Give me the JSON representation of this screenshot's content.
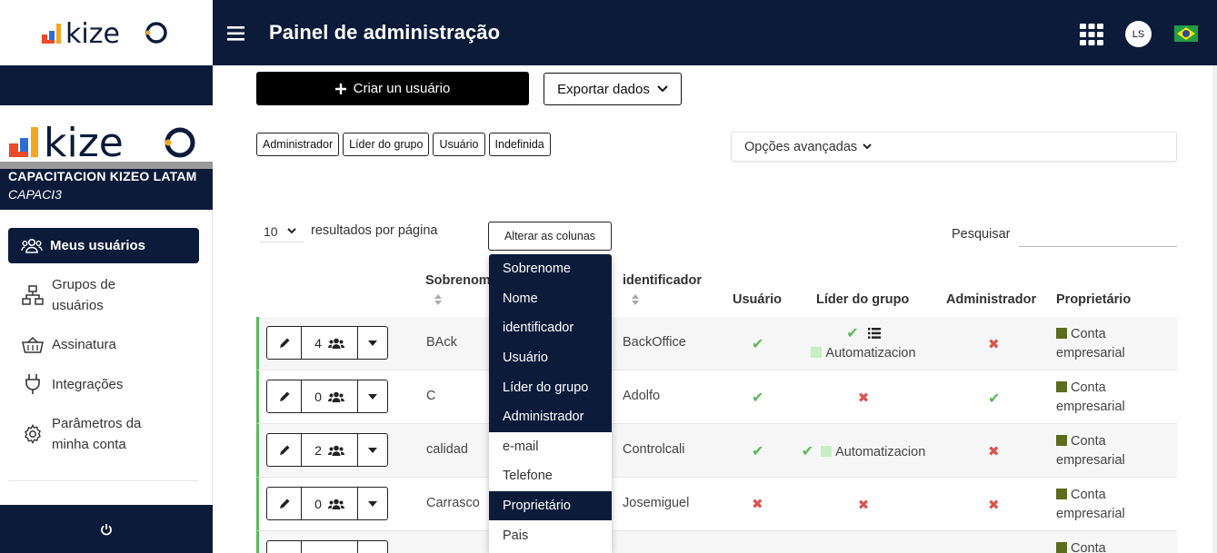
{
  "brand": {
    "logo_text": "kizeo"
  },
  "header": {
    "title": "Painel de administração",
    "avatar_initials": "LS"
  },
  "company": {
    "name": "CAPACITACION KIZEO LATAM",
    "code": "CAPACI3"
  },
  "nav": [
    {
      "label": "Meus usuários",
      "active": true,
      "icon": "users-icon"
    },
    {
      "label": "Grupos de usuários",
      "icon": "sitemap-icon"
    },
    {
      "label": "Assinatura",
      "icon": "basket-icon"
    },
    {
      "label": "Integrações",
      "icon": "plug-icon"
    },
    {
      "label": "Parâmetros da minha conta",
      "icon": "gear-icon"
    }
  ],
  "toolbar": {
    "create_label": "Criar un usuário",
    "export_label": "Exportar dados"
  },
  "filters": [
    "Administrador",
    "Líder do grupo",
    "Usuário",
    "Indefinida"
  ],
  "advanced_label": "Opções avançadas",
  "table_controls": {
    "page_length": "10",
    "page_length_label": "resultados por página",
    "columns_button": "Alterar as colunas",
    "search_label": "Pesquisar"
  },
  "columns": {
    "surname": "Sobrenome",
    "identifier": "identificador",
    "user": "Usuário",
    "leader": "Líder do grupo",
    "admin": "Administrador",
    "owner": "Proprietário"
  },
  "rows": [
    {
      "count": "4",
      "surname": "BAck",
      "identifier": "BackOffice",
      "user": true,
      "leader_check": true,
      "leader_list": true,
      "leader_group": "Automatizacion",
      "admin": false,
      "owner": [
        "Conta",
        "empresarial"
      ]
    },
    {
      "count": "0",
      "surname": "C",
      "identifier": "Adolfo",
      "user": true,
      "leader_check": false,
      "leader_group": "",
      "admin": true,
      "owner": [
        "Conta",
        "empresarial"
      ]
    },
    {
      "count": "2",
      "surname": "calidad",
      "identifier": "Controlcali",
      "user": true,
      "leader_check": true,
      "leader_group": "Automatizacion",
      "admin": false,
      "owner": [
        "Conta",
        "empresarial"
      ]
    },
    {
      "count": "0",
      "surname": "Carrasco",
      "identifier": "Josemiguel",
      "user": false,
      "leader_check": false,
      "leader_group": "",
      "admin": false,
      "owner": [
        "Conta",
        "empresarial"
      ]
    }
  ],
  "partial_row_owner": "Conta",
  "column_menu": [
    {
      "label": "Sobrenome",
      "on": true
    },
    {
      "label": "Nome",
      "on": true
    },
    {
      "label": "identificador",
      "on": true
    },
    {
      "label": "Usuário",
      "on": true
    },
    {
      "label": "Líder do grupo",
      "on": true
    },
    {
      "label": "Administrador",
      "on": true
    },
    {
      "label": "e-mail",
      "on": false
    },
    {
      "label": "Telefone",
      "on": false
    },
    {
      "label": "Proprietário",
      "on": true
    },
    {
      "label": "Pais",
      "on": false
    }
  ],
  "colors": {
    "navy": "#0c1b3a",
    "check": "#5cb85c",
    "cross": "#d9534f",
    "owner": "#5c6b1e"
  }
}
